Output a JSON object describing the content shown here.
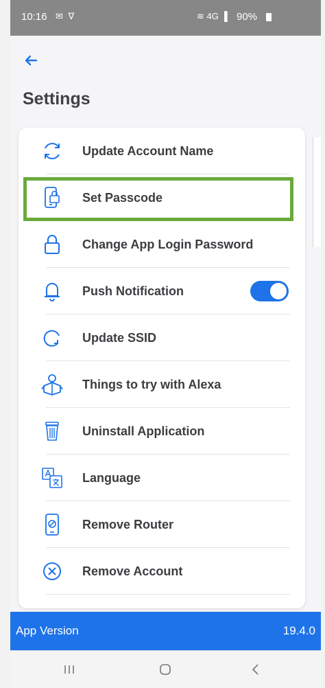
{
  "status_bar": {
    "time": "10:16",
    "left_icons": "✉ ∇",
    "right_icons": "≋ 4G ▐",
    "battery": "90%"
  },
  "header": {
    "title": "Settings",
    "back_icon": "back-arrow-icon"
  },
  "accent_color": "#1e73e8",
  "highlight_color": "#6aaa3a",
  "settings": {
    "items": [
      {
        "label": "Update Account Name",
        "icon": "refresh-icon"
      },
      {
        "label": "Set Passcode",
        "icon": "phone-lock-icon",
        "highlighted": true
      },
      {
        "label": "Change App Login Password",
        "icon": "lock-icon"
      },
      {
        "label": "Push Notification",
        "icon": "bell-icon",
        "toggle": "on"
      },
      {
        "label": "Update SSID",
        "icon": "circular-arrow-icon"
      },
      {
        "label": "Things to try with Alexa",
        "icon": "alexa-person-icon"
      },
      {
        "label": "Uninstall Application",
        "icon": "trash-icon"
      },
      {
        "label": "Language",
        "icon": "translate-icon"
      },
      {
        "label": "Remove Router",
        "icon": "remove-router-icon"
      },
      {
        "label": "Remove Account",
        "icon": "close-circle-icon"
      }
    ]
  },
  "footer": {
    "version_label": "App Version",
    "version_value": "19.4.0"
  },
  "nav": {
    "recents": "recents-icon",
    "home": "home-icon",
    "back": "back-icon"
  }
}
